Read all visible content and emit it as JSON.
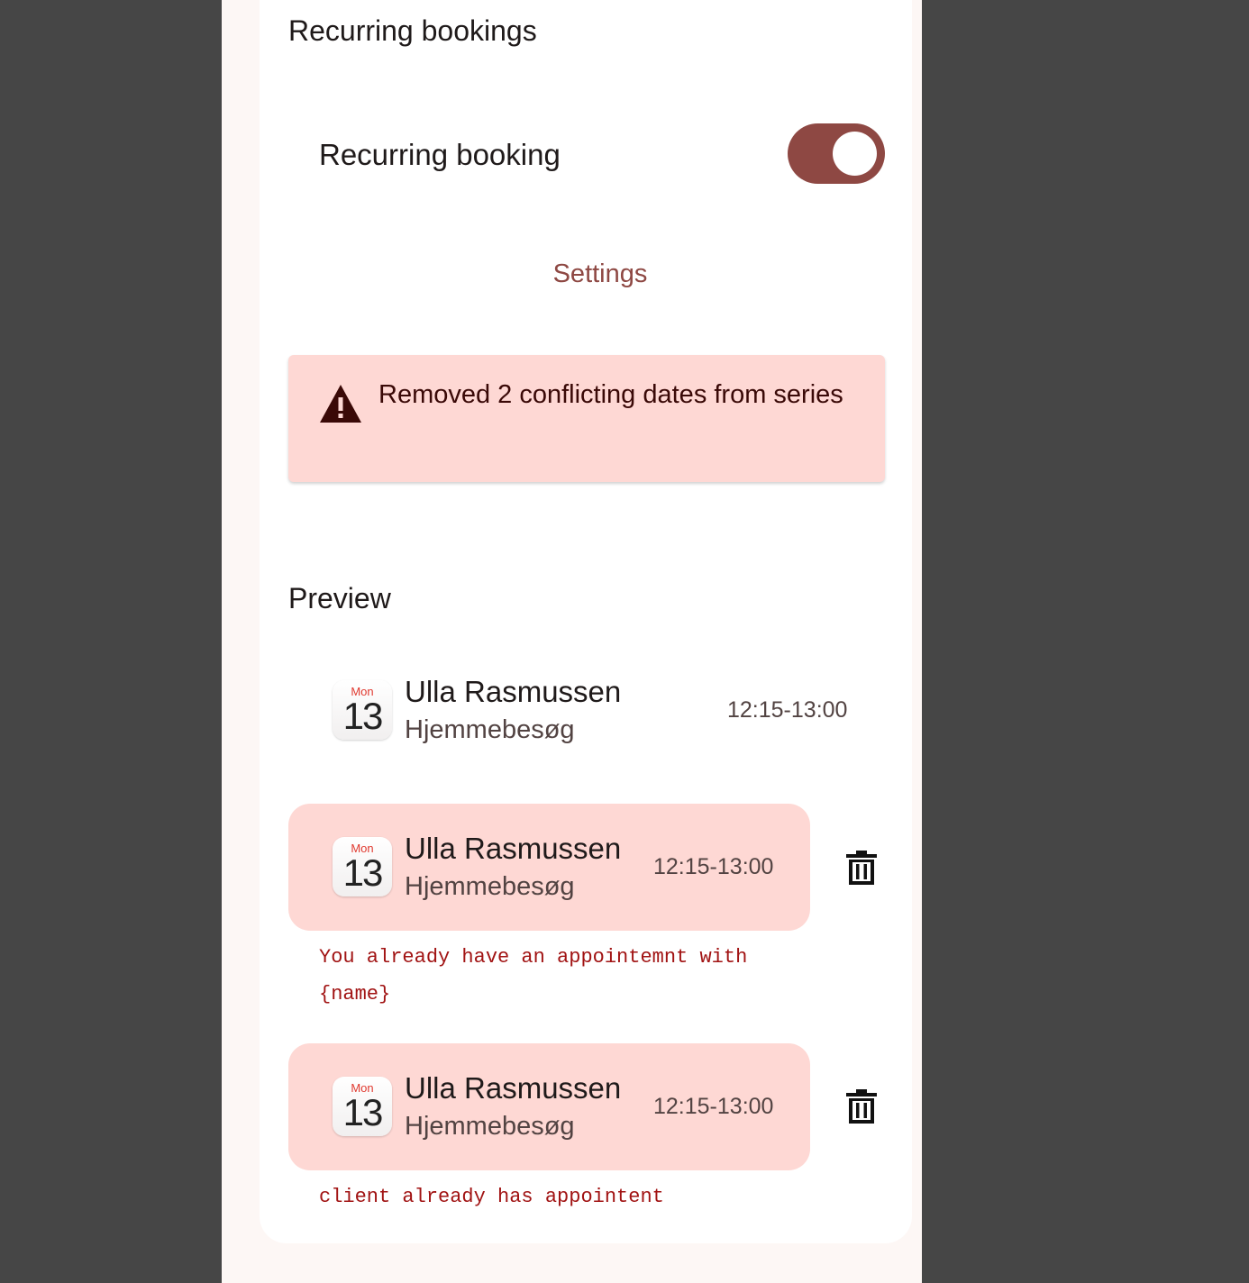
{
  "recurring": {
    "section_title": "Recurring bookings",
    "toggle_label": "Recurring booking",
    "toggle_on": true,
    "settings_label": "Settings",
    "alert_text": "Removed 2 conflicting dates from series",
    "alert_icon": "warning-icon"
  },
  "preview": {
    "title": "Preview",
    "items": [
      {
        "day_of_week": "Mon",
        "day": "13",
        "name": "Ulla Rasmussen",
        "type": "Hjemmebesøg",
        "time": "12:15-13:00",
        "conflict": false
      },
      {
        "day_of_week": "Mon",
        "day": "13",
        "name": "Ulla Rasmussen",
        "type": "Hjemmebesøg",
        "time": "12:15-13:00",
        "conflict": true,
        "error": "You already have an appointemnt with {name}"
      },
      {
        "day_of_week": "Mon",
        "day": "13",
        "name": "Ulla Rasmussen",
        "type": "Hjemmebesøg",
        "time": "12:15-13:00",
        "conflict": true,
        "error": "client already has appointent"
      }
    ]
  },
  "colors": {
    "accent": "#8e4843",
    "conflict_bg": "#fed8d4",
    "error_text": "#a11313",
    "backdrop": "#464646"
  },
  "icons": {
    "delete": "trash-icon",
    "calendar": "calendar-icon"
  }
}
